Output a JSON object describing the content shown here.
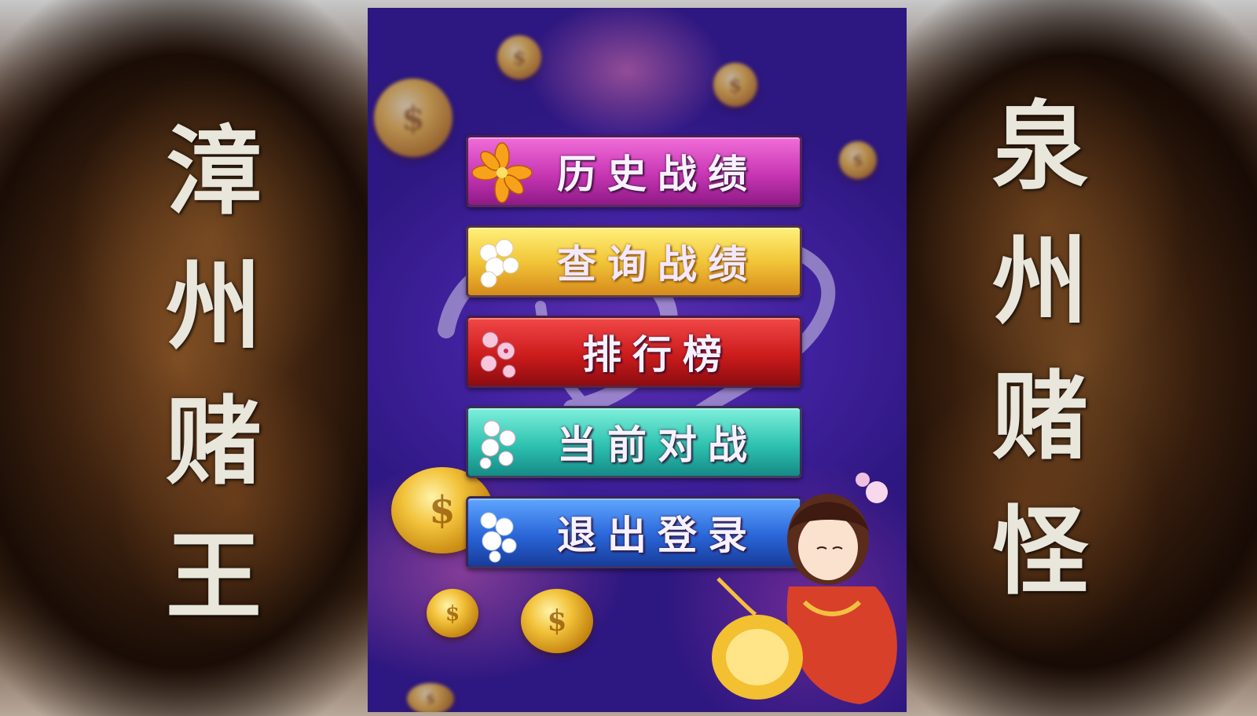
{
  "left_title": [
    "漳",
    "州",
    "赌",
    "王"
  ],
  "right_title": [
    "泉",
    "州",
    "赌",
    "怪"
  ],
  "menu": {
    "items": [
      {
        "label": "历史战绩",
        "icon": "orange-flower-icon"
      },
      {
        "label": "查询战绩",
        "icon": "white-flower-icon"
      },
      {
        "label": "排行榜",
        "icon": "pink-blossom-icon"
      },
      {
        "label": "当前对战",
        "icon": "white-blossom-icon"
      },
      {
        "label": "退出登录",
        "icon": "white-flower-icon"
      }
    ]
  },
  "colors": {
    "panel_purple": "#4222a0",
    "button_magenta": "#c836b4",
    "button_gold": "#f2c638",
    "button_red": "#cc1c1c",
    "button_teal": "#2ec2b0",
    "button_blue": "#2a66d8",
    "title_text": "#e9e6dc"
  }
}
